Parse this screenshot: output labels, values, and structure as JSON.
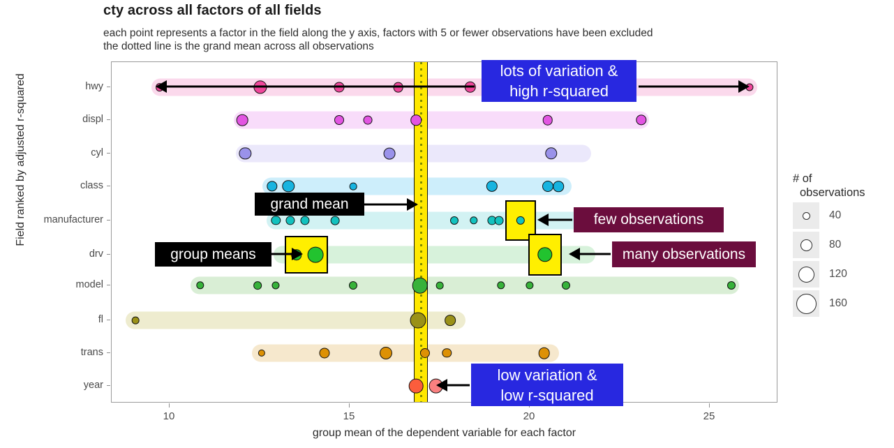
{
  "chart_data": {
    "type": "scatter",
    "title": "cty across all factors of all fields",
    "subtitle": "each point represents a factor in the field along the y axis, factors with 5 or fewer observations have been excluded\nthe dotted line is the grand mean across all observations",
    "xlabel": "group mean of the dependent variable for each factor",
    "ylabel": "Field ranked by adjusted r-squared",
    "xlim": [
      8.6,
      26.8
    ],
    "xticks": [
      10,
      15,
      20,
      25
    ],
    "grid": false,
    "grand_mean": 16.98,
    "categories": [
      "hwy",
      "displ",
      "cyl",
      "class",
      "manufacturer",
      "drv",
      "model",
      "fl",
      "trans",
      "year"
    ],
    "legend": {
      "title": "# of\n observations",
      "title_line1": "# of",
      "title_line2": "observations",
      "entries": [
        {
          "label": "40",
          "size": 11
        },
        {
          "label": "80",
          "size": 17
        },
        {
          "label": "120",
          "size": 23
        },
        {
          "label": "160",
          "size": 29
        }
      ]
    },
    "series": [
      {
        "name": "hwy",
        "color": "#f0469b",
        "band": "#fbd9ec",
        "row": 0,
        "range": [
          9.7,
          26.1
        ],
        "points": [
          {
            "x": 9.72,
            "n": 18
          },
          {
            "x": 12.52,
            "n": 95
          },
          {
            "x": 14.7,
            "n": 45
          },
          {
            "x": 16.35,
            "n": 42
          },
          {
            "x": 18.35,
            "n": 60
          },
          {
            "x": 26.1,
            "n": 14
          }
        ]
      },
      {
        "name": "displ",
        "color": "#e255e2",
        "band": "#f8dcfa",
        "row": 1,
        "range": [
          12.0,
          23.1
        ],
        "points": [
          {
            "x": 12.02,
            "n": 62
          },
          {
            "x": 14.7,
            "n": 35
          },
          {
            "x": 15.5,
            "n": 26
          },
          {
            "x": 16.85,
            "n": 50
          },
          {
            "x": 20.5,
            "n": 40
          },
          {
            "x": 23.1,
            "n": 48
          }
        ]
      },
      {
        "name": "cyl",
        "color": "#9a92ea",
        "band": "#ebe8fb",
        "row": 2,
        "range": [
          12.05,
          21.5
        ],
        "points": [
          {
            "x": 12.1,
            "n": 70
          },
          {
            "x": 16.1,
            "n": 65
          },
          {
            "x": 20.6,
            "n": 72
          }
        ]
      },
      {
        "name": "class",
        "color": "#17b4e0",
        "band": "#cdeefb",
        "row": 3,
        "range": [
          12.8,
          20.95
        ],
        "points": [
          {
            "x": 12.85,
            "n": 48
          },
          {
            "x": 13.3,
            "n": 72
          },
          {
            "x": 15.1,
            "n": 12
          },
          {
            "x": 18.95,
            "n": 58
          },
          {
            "x": 20.5,
            "n": 55
          },
          {
            "x": 20.8,
            "n": 50
          }
        ]
      },
      {
        "name": "manufacturer",
        "color": "#12c2bf",
        "band": "#d2f2f3",
        "row": 4,
        "range": [
          12.9,
          22.3
        ],
        "points": [
          {
            "x": 12.95,
            "n": 30
          },
          {
            "x": 13.35,
            "n": 28
          },
          {
            "x": 13.75,
            "n": 28
          },
          {
            "x": 14.6,
            "n": 25
          },
          {
            "x": 17.9,
            "n": 20
          },
          {
            "x": 18.45,
            "n": 16
          },
          {
            "x": 18.95,
            "n": 28
          },
          {
            "x": 19.15,
            "n": 26
          },
          {
            "x": 19.75,
            "n": 22
          },
          {
            "x": 22.3,
            "n": 14
          }
        ]
      },
      {
        "name": "drv",
        "color": "#22c32f",
        "band": "#d7f2db",
        "row": 5,
        "range": [
          13.1,
          21.6
        ],
        "points": [
          {
            "x": 13.52,
            "n": 50
          },
          {
            "x": 14.05,
            "n": 155
          },
          {
            "x": 20.42,
            "n": 130
          }
        ]
      },
      {
        "name": "model",
        "color": "#37b23a",
        "band": "#d9eed5",
        "row": 6,
        "range": [
          10.8,
          25.6
        ],
        "points": [
          {
            "x": 10.85,
            "n": 16
          },
          {
            "x": 12.45,
            "n": 18
          },
          {
            "x": 12.95,
            "n": 14
          },
          {
            "x": 15.1,
            "n": 20
          },
          {
            "x": 16.95,
            "n": 150
          },
          {
            "x": 17.5,
            "n": 12
          },
          {
            "x": 19.2,
            "n": 16
          },
          {
            "x": 20.0,
            "n": 15
          },
          {
            "x": 21.0,
            "n": 20
          },
          {
            "x": 25.6,
            "n": 20
          }
        ]
      },
      {
        "name": "fl",
        "color": "#9a9118",
        "band": "#eeeccf",
        "row": 7,
        "range": [
          9.0,
          18.0
        ],
        "points": [
          {
            "x": 9.05,
            "n": 12
          },
          {
            "x": 16.9,
            "n": 158
          },
          {
            "x": 17.8,
            "n": 52
          }
        ]
      },
      {
        "name": "trans",
        "color": "#dd9105",
        "band": "#f6e8cd",
        "row": 8,
        "range": [
          12.5,
          20.6
        ],
        "points": [
          {
            "x": 12.55,
            "n": 10
          },
          {
            "x": 14.3,
            "n": 45
          },
          {
            "x": 16.0,
            "n": 80
          },
          {
            "x": 17.1,
            "n": 36
          },
          {
            "x": 17.7,
            "n": 30
          },
          {
            "x": 20.4,
            "n": 62
          }
        ]
      },
      {
        "name": "year",
        "color": "#fb5d3c",
        "band": "#ffffff",
        "row": 9,
        "range": [
          16.7,
          17.45
        ],
        "points": [
          {
            "x": 16.85,
            "n": 118,
            "color": "#fb5d3c"
          },
          {
            "x": 17.4,
            "n": 118,
            "color": "#f98080"
          }
        ]
      }
    ],
    "annotations": [
      {
        "id": "lots-of-variation",
        "text": "lots of variation &\nhigh r-squared",
        "style": "blue"
      },
      {
        "id": "grand-mean",
        "text": "grand mean",
        "style": "black"
      },
      {
        "id": "few-observations",
        "text": "few observations",
        "style": "maroon"
      },
      {
        "id": "group-means",
        "text": "group means",
        "style": "black"
      },
      {
        "id": "many-observations",
        "text": "many observations",
        "style": "maroon"
      },
      {
        "id": "low-variation",
        "text": "low variation &\nlow r-squared",
        "style": "blue"
      }
    ]
  }
}
